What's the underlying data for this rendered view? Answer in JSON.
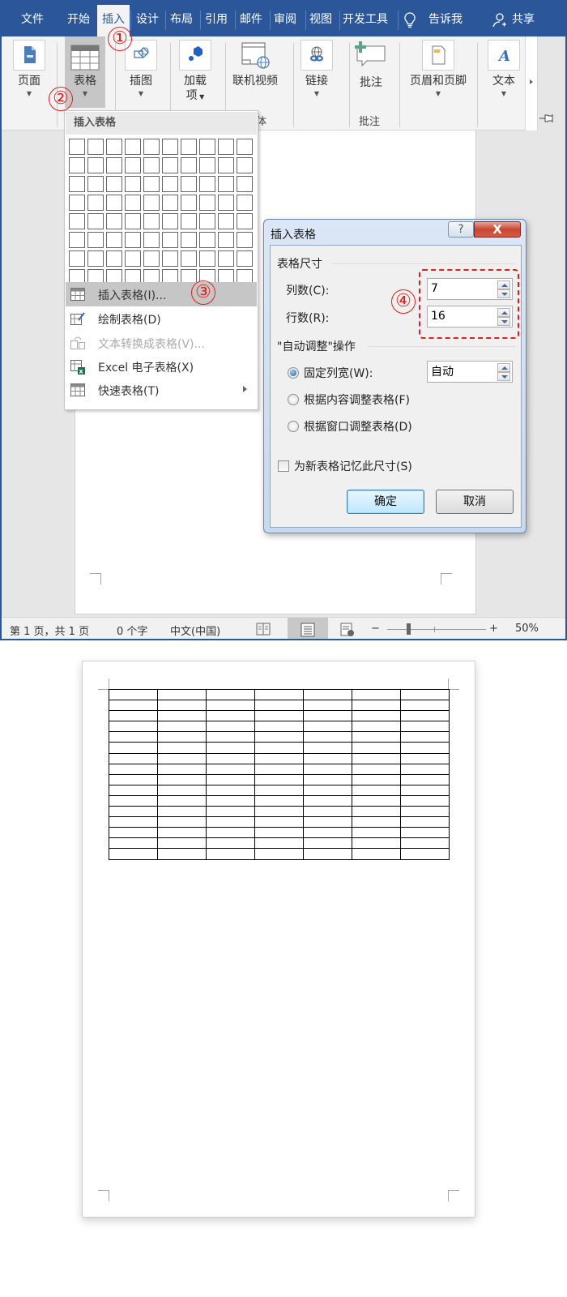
{
  "tabs": [
    {
      "label": "文件"
    },
    {
      "label": "开始"
    },
    {
      "label": "插入",
      "active": true
    },
    {
      "label": "设计"
    },
    {
      "label": "布局"
    },
    {
      "label": "引用"
    },
    {
      "label": "邮件"
    },
    {
      "label": "审阅"
    },
    {
      "label": "视图"
    },
    {
      "label": "开发工具"
    }
  ],
  "tell_me": "告诉我",
  "share": "共享",
  "ribbon": {
    "buttons": {
      "pages": "页面",
      "table": "表格",
      "illustrations": "插图",
      "addins": "加载项",
      "addins_line1": "加载",
      "addins_line2": "项",
      "online_video": "联机视频",
      "links": "链接",
      "comment": "批注",
      "header_footer": "页眉和页脚",
      "text": "文本"
    },
    "group_labels": {
      "media_partial": "体",
      "comments": "批注"
    }
  },
  "table_menu": {
    "header": "插入表格",
    "grid_cols": 10,
    "grid_rows": 8,
    "items": [
      {
        "label": "插入表格(I)...",
        "icon": "table-icon",
        "highlighted": true
      },
      {
        "label": "绘制表格(D)",
        "icon": "draw-table-icon"
      },
      {
        "label": "文本转换成表格(V)...",
        "icon": "text-to-table-icon",
        "disabled": true
      },
      {
        "label": "Excel 电子表格(X)",
        "icon": "excel-table-icon"
      },
      {
        "label": "快速表格(T)",
        "icon": "quick-table-icon",
        "submenu": true
      }
    ]
  },
  "dialog": {
    "title": "插入表格",
    "help": "?",
    "close": "X",
    "size_section": "表格尺寸",
    "columns_label": "列数(C):",
    "columns_value": "7",
    "rows_label": "行数(R):",
    "rows_value": "16",
    "autofit_section": "\"自动调整\"操作",
    "fixed_width_label": "固定列宽(W):",
    "fixed_width_value": "自动",
    "autofit_contents_label": "根据内容调整表格(F)",
    "autofit_window_label": "根据窗口调整表格(D)",
    "selected_option": "fixed_width",
    "remember_label": "为新表格记忆此尺寸(S)",
    "remember_checked": false,
    "ok": "确定",
    "cancel": "取消"
  },
  "annotations": [
    "①",
    "②",
    "③",
    "④"
  ],
  "status_bar": {
    "page": "第 1 页，共 1 页",
    "words": "0 个字",
    "language": "中文(中国)",
    "zoom_minus": "−",
    "zoom_plus": "+",
    "zoom_level": "50%",
    "zoom_percent": 50
  },
  "result_table": {
    "columns": 7,
    "rows": 16
  }
}
